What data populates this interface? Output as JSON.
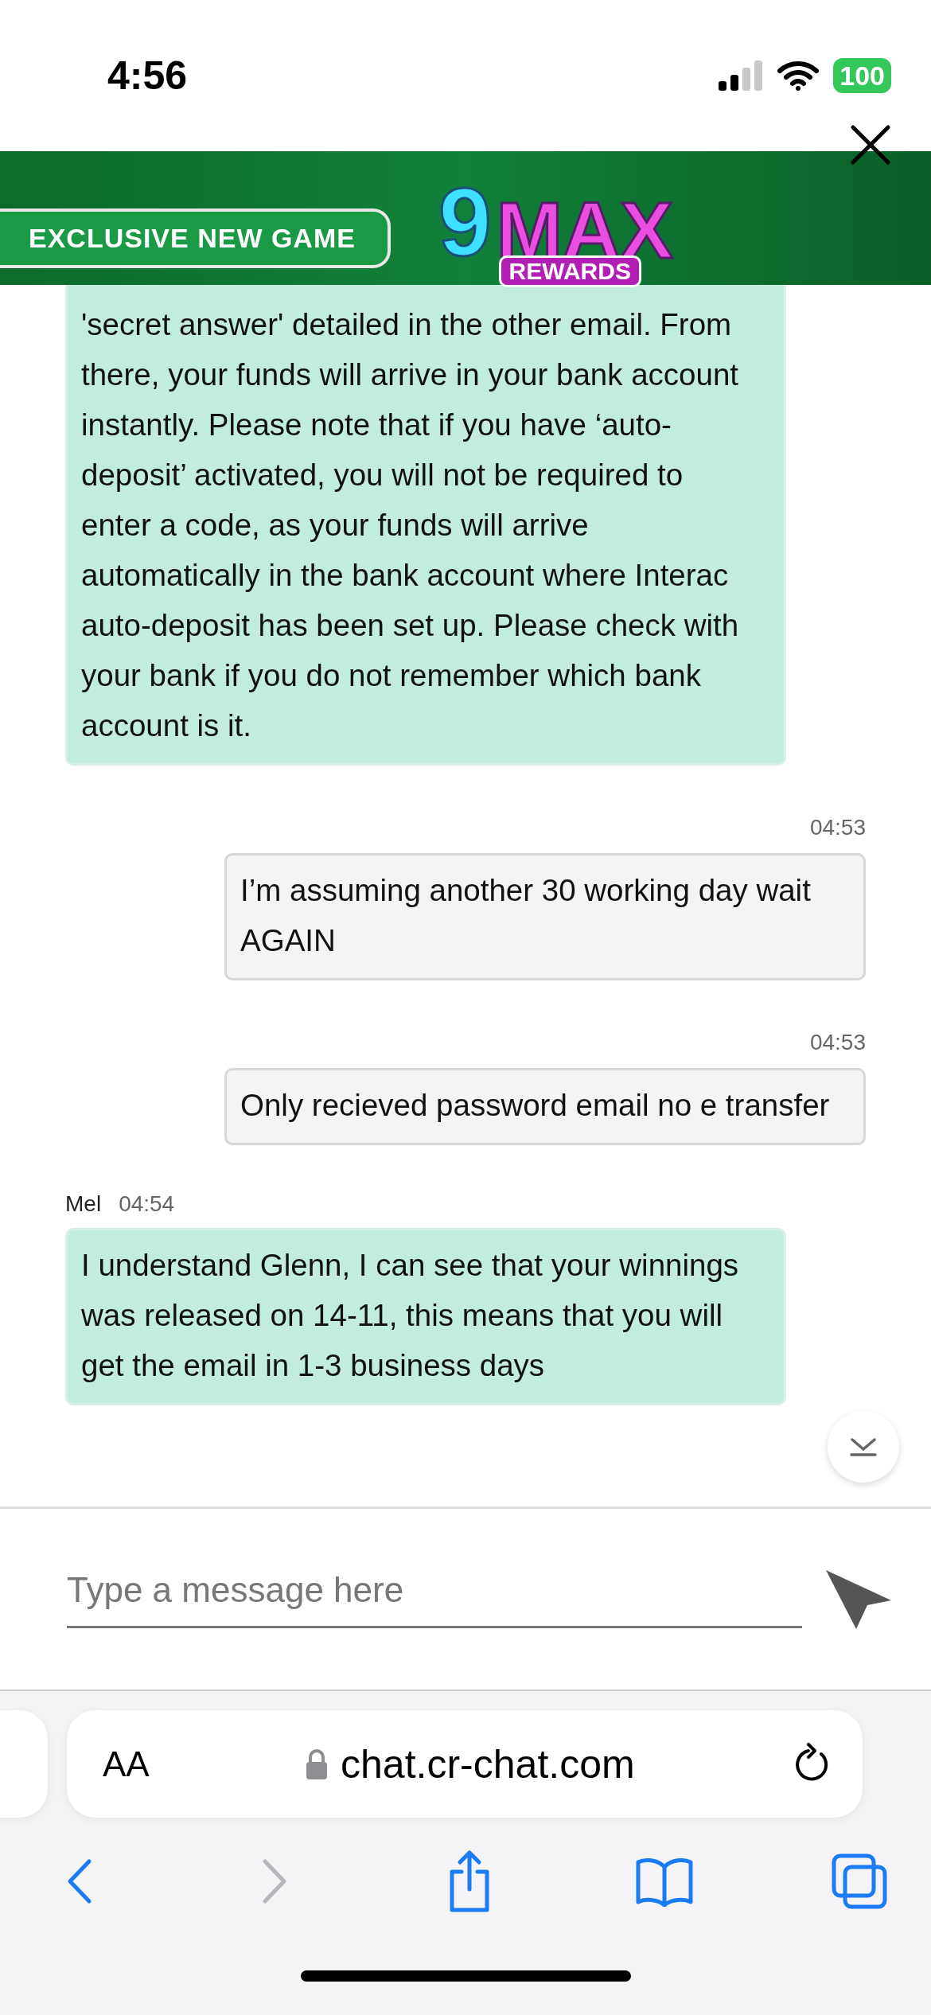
{
  "status_bar": {
    "time": "4:56",
    "battery": "100"
  },
  "ad_banner": {
    "tagline": "EXCLUSIVE NEW GAME",
    "logo_number": "9",
    "logo_word": "MAX",
    "logo_badge": "REWARDS"
  },
  "messages": [
    {
      "kind": "agent",
      "text": "'secret answer' detailed in the other email. From there, your funds will arrive in your bank account instantly. Please note that if you have ‘auto-deposit’ activated, you will not be required to enter a code, as your funds will arrive automatically in the bank account where Interac auto-deposit has been set up. Please check with your bank if you do not remember which bank account is it."
    },
    {
      "kind": "user",
      "time": "04:53",
      "text": "I’m assuming another 30 working day wait AGAIN"
    },
    {
      "kind": "user",
      "time": "04:53",
      "text": "Only recieved password email no e transfer"
    },
    {
      "kind": "agent",
      "sender": "Mel",
      "time": "04:54",
      "text": "I understand Glenn, I can see that your winnings was released on 14-11, this means that you will get the email in 1-3 business days"
    }
  ],
  "composer": {
    "placeholder": "Type a message here"
  },
  "browser": {
    "text_size": "AA",
    "url": "chat.cr-chat.com",
    "nav": [
      {
        "kind": "back",
        "disabled": false
      },
      {
        "kind": "forward",
        "disabled": true
      },
      {
        "kind": "share",
        "disabled": false
      },
      {
        "kind": "bookmarks",
        "disabled": false
      },
      {
        "kind": "tabs",
        "disabled": false
      }
    ]
  }
}
